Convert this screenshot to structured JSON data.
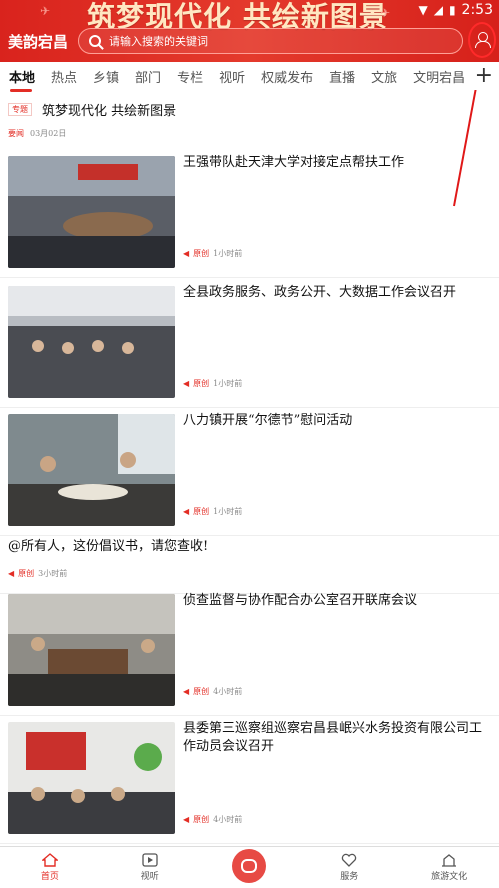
{
  "header": {
    "banner": "筑梦现代化 共绘新图景",
    "status_time": "2:53",
    "logo": "美韵宕昌",
    "search_placeholder": "请输入搜索的关键词"
  },
  "tabs": [
    "本地",
    "热点",
    "乡镇",
    "部门",
    "专栏",
    "视听",
    "权威发布",
    "直播",
    "文旅",
    "文明宕昌"
  ],
  "topic": {
    "badge": "专题",
    "title": "筑梦现代化 共绘新图景",
    "source": "要闻",
    "date": "03月02日"
  },
  "feed": [
    {
      "title": "王强带队赴天津大学对接定点帮扶工作",
      "tag": "原创",
      "time": "1小时前"
    },
    {
      "title": "全县政务服务、政务公开、大数据工作会议召开",
      "tag": "原创",
      "time": "1小时前"
    },
    {
      "title": "八力镇开展“尔德节”慰问活动",
      "tag": "原创",
      "time": "1小时前"
    },
    {
      "title": "@所有人，这份倡议书，请您查收!",
      "tag": "原创",
      "time": "3小时前"
    },
    {
      "title": "侦查监督与协作配合办公室召开联席会议",
      "tag": "原创",
      "time": "4小时前"
    },
    {
      "title": "县委第三巡察组巡察宕昌县岷兴水务投资有限公司工作动员会议召开",
      "tag": "原创",
      "time": "4小时前"
    }
  ],
  "bottom_nav": [
    "首页",
    "视听",
    "",
    "服务",
    "旅游文化"
  ],
  "colors": {
    "brand": "#e32d25",
    "header": "#d9231d"
  }
}
